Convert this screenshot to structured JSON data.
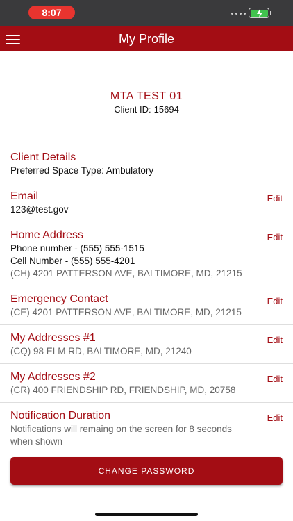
{
  "status_bar": {
    "time": "8:07",
    "battery_color": "#41c24e"
  },
  "header": {
    "title": "My Profile",
    "menu_icon": "hamburger-menu-icon",
    "brand_color": "#a30d14"
  },
  "profile": {
    "name": "MTA TEST 01",
    "client_id_label": "Client ID:",
    "client_id": "15694"
  },
  "sections": {
    "client_details": {
      "title": "Client Details",
      "lines": [
        "Preferred Space Type: Ambulatory"
      ]
    },
    "email": {
      "title": "Email",
      "edit": "Edit",
      "lines": [
        "123@test.gov"
      ]
    },
    "home_address": {
      "title": "Home Address",
      "edit": "Edit",
      "lines": [
        "Phone number - (555) 555-1515",
        "Cell Number - (555) 555-4201",
        "(CH) 4201 PATTERSON AVE, BALTIMORE, MD, 21215"
      ]
    },
    "emergency_contact": {
      "title": "Emergency Contact",
      "edit": "Edit",
      "lines": [
        "(CE) 4201 PATTERSON AVE, BALTIMORE, MD, 21215"
      ]
    },
    "address_1": {
      "title": "My Addresses #1",
      "edit": "Edit",
      "lines": [
        "(CQ) 98 ELM RD, BALTIMORE, MD, 21240"
      ]
    },
    "address_2": {
      "title": "My Addresses #2",
      "edit": "Edit",
      "lines": [
        "(CR) 400 FRIENDSHIP RD, FRIENDSHIP, MD, 20758"
      ]
    },
    "notification": {
      "title": "Notification Duration",
      "edit": "Edit",
      "lines": [
        "Notifications will remaing on the screen for 8 seconds",
        "when shown"
      ]
    }
  },
  "change_password_label": "CHANGE PASSWORD"
}
